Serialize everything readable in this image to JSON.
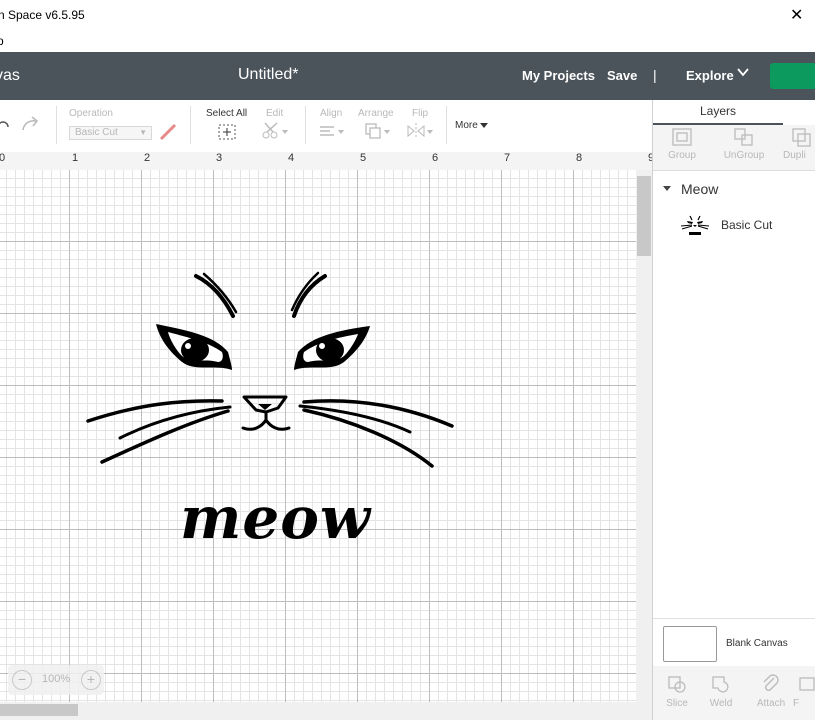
{
  "window": {
    "title": "n Space  v6.5.95",
    "close_glyph": "✕",
    "menu": "p"
  },
  "header": {
    "canvas_label": "vas",
    "doc_title": "Untitled*",
    "my_projects": "My Projects",
    "save": "Save",
    "separator": "|",
    "explore": "Explore",
    "make_color": "#0c9a5e"
  },
  "toolbar": {
    "operation_label": "Operation",
    "operation_value": "Basic Cut",
    "select_all": "Select All",
    "edit": "Edit",
    "align": "Align",
    "arrange": "Arrange",
    "flip": "Flip",
    "more": "More"
  },
  "ruler": {
    "numbers": [
      "0",
      "1",
      "2",
      "3",
      "4",
      "5",
      "6",
      "7",
      "8",
      "9"
    ]
  },
  "canvas": {
    "text": "meow",
    "zoom": "100%",
    "zoom_minus": "−",
    "zoom_plus": "+"
  },
  "panel": {
    "tab": "Layers",
    "tools": {
      "group": "Group",
      "ungroup": "UnGroup",
      "duplicate": "Dupli"
    },
    "layer_group": "Meow",
    "layer_item": "Basic Cut",
    "blank_canvas": "Blank Canvas",
    "bottom": {
      "slice": "Slice",
      "weld": "Weld",
      "attach": "Attach",
      "flatten": "F"
    }
  }
}
